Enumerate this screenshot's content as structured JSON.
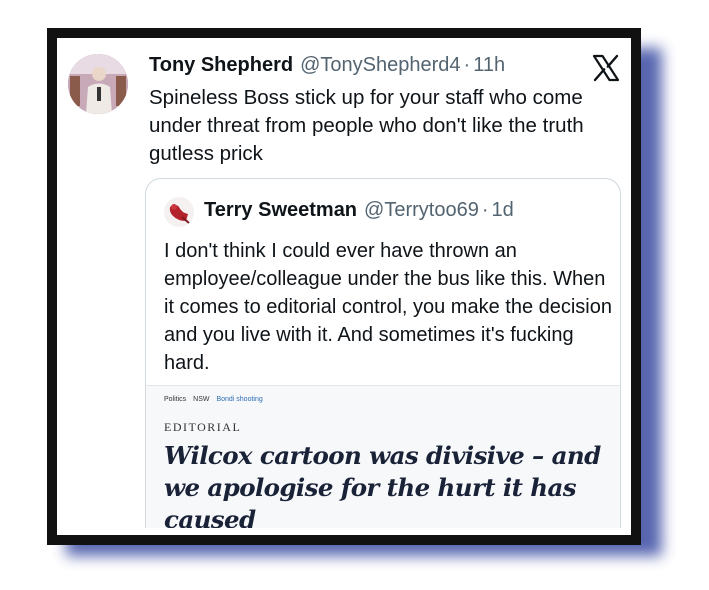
{
  "tweet": {
    "author": "Tony Shepherd",
    "handle": "@TonyShepherd4",
    "separator": "·",
    "time": "11h",
    "text": "Spineless Boss stick up for your staff who come under threat from people who don't like the truth gutless prick",
    "logo_icon": "x-logo-icon"
  },
  "quoted_tweet": {
    "author": "Terry Sweetman",
    "handle": "@Terrytoo69",
    "separator": "·",
    "time": "1d",
    "text": "I don't think I could ever have thrown an employee/colleague under the bus like this. When it comes to editorial control, you make the decision and you live with it. And sometimes it's fucking hard.",
    "article": {
      "crumbs": [
        "Politics",
        "NSW"
      ],
      "crumb_link": "Bondi shooting",
      "kicker": "EDITORIAL",
      "headline": "Wilcox cartoon was divisive – and we apologise for the hurt it has caused"
    }
  },
  "colors": {
    "frame": "#111111",
    "shadow": "#4656a8",
    "text": "#0f1419",
    "muted": "#536471",
    "headline": "#1a2238",
    "link": "#2f6db5"
  }
}
